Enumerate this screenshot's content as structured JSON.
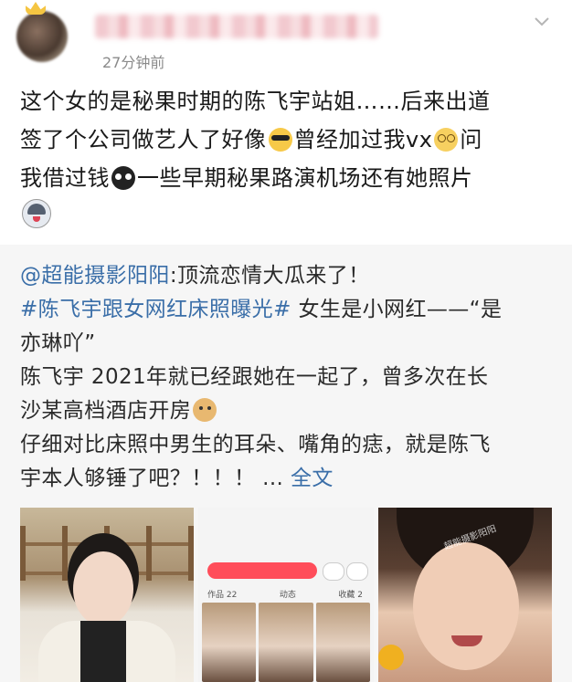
{
  "post": {
    "time": "27分钟前",
    "text_line1": "这个女的是秘果时期的陈飞宇站姐……后来出道",
    "text_line2a": "签了个公司做艺人了好像",
    "text_line2b": "曾经加过我vx",
    "text_line2c": "问",
    "text_line3a": "我借过钱",
    "text_line3b": "一些早期秘果路演机场还有她照片"
  },
  "repost": {
    "author": "@超能摄影阳阳",
    "author_colon": ":顶流恋情大瓜来了！",
    "hashtag": "#陈飞宇跟女网红床照曝光#",
    "line2_rest": " 女生是小网红——“是",
    "line3": "亦琳吖”",
    "line4": "陈飞宇 2021年就已经跟她在一起了，曾多次在长",
    "line5": "沙某高档酒店开房",
    "line6": "仔细对比床照中男生的耳朵、嘴角的痣，就是陈飞",
    "line7": "宇本人够锤了吧？！！！ ... ",
    "full_text_link": "全文"
  },
  "photos": {
    "p2_tab1": "作品 22",
    "p2_tab2": "动态",
    "p2_tab3": "收藏 2",
    "watermark": "超能摄影阳阳"
  },
  "colors": {
    "link": "#3a6ea8",
    "repost_bg": "#f6f6f6"
  }
}
